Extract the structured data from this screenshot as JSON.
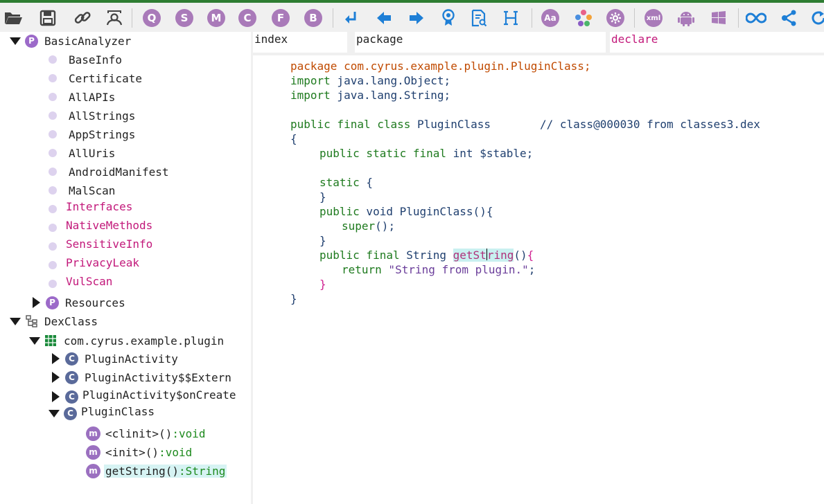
{
  "tree": {
    "basic_analyzer": {
      "label": "BasicAnalyzer",
      "items": [
        "BaseInfo",
        "Certificate",
        "AllAPIs",
        "AllStrings",
        "AppStrings",
        "AllUris",
        "AndroidManifest",
        "MalScan"
      ],
      "pink_items": [
        "Interfaces",
        "NativeMethods",
        "SensitiveInfo",
        "PrivacyLeak",
        "VulScan"
      ]
    },
    "resources": "Resources",
    "dexclass": "DexClass",
    "package": "com.cyrus.example.plugin",
    "classes": [
      "PluginActivity",
      "PluginActivity$$Extern",
      "PluginActivity$onCreate"
    ],
    "plugin_class": "PluginClass",
    "methods": [
      {
        "name": "<clinit>()",
        "ret": ":void"
      },
      {
        "name": "<init>()",
        "ret": ":void"
      },
      {
        "name": "getString()",
        "ret": ":String"
      }
    ]
  },
  "table": {
    "headers": [
      "index",
      "package",
      "declare"
    ]
  },
  "code": {
    "pkg_kw": "package",
    "pkg_name": " com.cyrus.example.plugin.PluginClass;",
    "import_kw": "import",
    "import1": " java.lang.Object;",
    "import2": " java.lang.String;",
    "cls_mods": "public final class",
    "cls_name": " PluginClass",
    "cls_comment": "// class@000030 from classes3.dex",
    "open_brace": "{",
    "field_mods": "public static final",
    "field_rest": " int $stable;",
    "static_kw": "static",
    "static_rest": " {",
    "close": "}",
    "ctor_mods": "public",
    "ctor_rest": " void PluginClass(){",
    "super_kw": "super",
    "super_rest": "();",
    "m_mods": "public final",
    "m_type": " String ",
    "m_name_a": "getSt",
    "m_name_b": "ring",
    "m_paren": "()",
    "m_brace": "{",
    "ret_kw": "return",
    "ret_str": " \"String from plugin.\"",
    "ret_semi": ";"
  },
  "icon_colors": {
    "purple": "#a97ab9",
    "blue": "#1e7fd6",
    "green": "#2e7d32"
  }
}
